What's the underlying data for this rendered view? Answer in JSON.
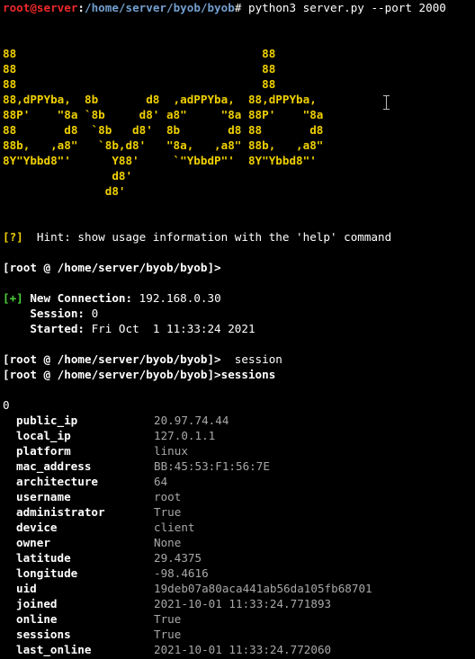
{
  "prompt_line": {
    "user_host": "root@server",
    "colon": ":",
    "path": "/home/server/byob/byob",
    "symbol": "# ",
    "command": "python3 server.py --port 2000"
  },
  "banner": [
    "88                                    88",
    "88                                    88",
    "88                                    88",
    "88,dPPYba,  8b       d8  ,adPPYba,  88,dPPYba,",
    "88P'    \"8a `8b     d8' a8\"     \"8a 88P'    \"8a",
    "88       d8  `8b   d8'  8b       d8 88       d8",
    "88b,   ,a8\"   `8b,d8'   \"8a,   ,a8\" 88b,   ,a8\"",
    "8Y\"Ybbd8\"'      Y88'     `\"YbbdP\"'  8Y\"Ybbd8\"'",
    "                d8'",
    "               d8'"
  ],
  "hint": {
    "tag": "[?]",
    "text": "  Hint: show usage information with the 'help' command"
  },
  "shell_prompt": "[root @ /home/server/byob/byob]>",
  "connection": {
    "tag": "[+]",
    "title_label": " New Connection:",
    "title_value": " 192.168.0.30",
    "session_label": "    Session:",
    "session_value": " 0",
    "started_label": "    Started:",
    "started_value": " Fri Oct  1 11:33:24 2021"
  },
  "cmd1": {
    "prompt": "[root @ /home/server/byob/byob]>",
    "text": "  session"
  },
  "cmd2": {
    "prompt": "[root @ /home/server/byob/byob]>",
    "text": "sessions"
  },
  "session_index": "0",
  "session_info": [
    {
      "key": "public_ip",
      "value": "20.97.74.44"
    },
    {
      "key": "local_ip",
      "value": "127.0.1.1"
    },
    {
      "key": "platform",
      "value": "linux"
    },
    {
      "key": "mac_address",
      "value": "BB:45:53:F1:56:7E"
    },
    {
      "key": "architecture",
      "value": "64"
    },
    {
      "key": "username",
      "value": "root"
    },
    {
      "key": "administrator",
      "value": "True"
    },
    {
      "key": "device",
      "value": "client"
    },
    {
      "key": "owner",
      "value": "None"
    },
    {
      "key": "latitude",
      "value": "29.4375"
    },
    {
      "key": "longitude",
      "value": "-98.4616"
    },
    {
      "key": "uid",
      "value": "19deb07a80aca441ab56da105fb68701"
    },
    {
      "key": "joined",
      "value": "2021-10-01 11:33:24.771893"
    },
    {
      "key": "online",
      "value": "True"
    },
    {
      "key": "sessions",
      "value": "True"
    },
    {
      "key": "last_online",
      "value": "2021-10-01 11:33:24.772060"
    }
  ],
  "colors": {
    "background": "#000000",
    "user_host": "#ef2929",
    "path": "#729fcf",
    "banner": "#f0d000",
    "tag": "#4bd33a",
    "value": "#a8a8a8"
  }
}
